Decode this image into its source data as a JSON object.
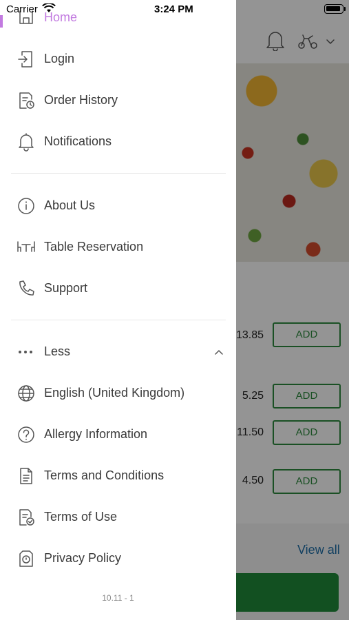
{
  "status_bar": {
    "carrier": "Carrier",
    "time": "3:24 PM"
  },
  "menu": {
    "home_label": "Home",
    "primary": [
      {
        "label": "Login",
        "icon": "login-icon"
      },
      {
        "label": "Order History",
        "icon": "order-history-icon"
      },
      {
        "label": "Notifications",
        "icon": "bell-icon"
      }
    ],
    "secondary": [
      {
        "label": "About Us",
        "icon": "info-icon"
      },
      {
        "label": "Table Reservation",
        "icon": "table-icon"
      },
      {
        "label": "Support",
        "icon": "phone-icon"
      }
    ],
    "less_label": "Less",
    "more": [
      {
        "label": "English (United Kingdom)",
        "icon": "globe-icon"
      },
      {
        "label": "Allergy Information",
        "icon": "question-icon"
      },
      {
        "label": "Terms and Conditions",
        "icon": "document-icon"
      },
      {
        "label": "Terms of Use",
        "icon": "document-check-icon"
      },
      {
        "label": "Privacy Policy",
        "icon": "privacy-icon"
      }
    ],
    "version": "10.11 - 1"
  },
  "background": {
    "items": [
      {
        "price": "13.85",
        "button": "ADD"
      },
      {
        "price": "5.25",
        "button": "ADD"
      },
      {
        "price": "11.50",
        "button": "ADD"
      },
      {
        "price": "4.50",
        "button": "ADD"
      }
    ],
    "view_all": "View all"
  },
  "colors": {
    "accent": "#c27ae0",
    "add_green": "#2e8b3e",
    "link_blue": "#1f6fa8"
  }
}
